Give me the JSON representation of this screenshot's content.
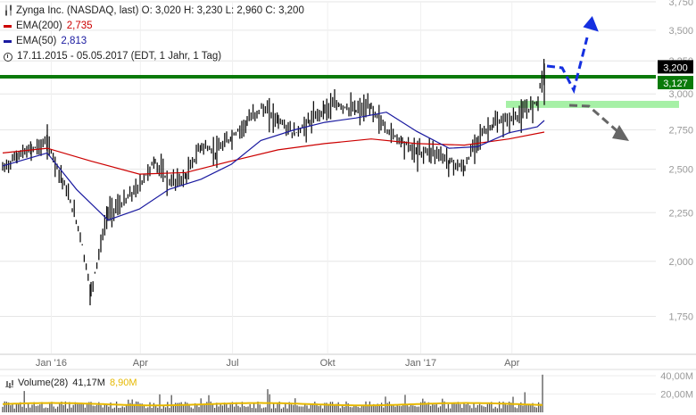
{
  "header": {
    "symbol_line": "Zynga Inc. (NASDAQ, last)  O: 3,020  H: 3,230  L: 2,960  C: 3,200",
    "ema200_label": "EMA(200)",
    "ema200_value": "2,735",
    "ema50_label": "EMA(50)",
    "ema50_value": "2,813",
    "range_line": "17.11.2015 - 05.05.2017  (EDT, 1 Jahr, 1 Tag)"
  },
  "volume_legend": {
    "label": "Volume(28)",
    "value": "41,17M",
    "avg_value": "8,90M"
  },
  "colors": {
    "price": "#111111",
    "ema200": "#cc0000",
    "ema50": "#1a1aa0",
    "resistance": "#0a7a0a",
    "support": "#a6f0a6",
    "arrow_up": "#1530e0",
    "arrow_down": "#666666",
    "last_price_box": "#000000",
    "resistance_box": "#0a7a0a",
    "volume_bar": "#555555",
    "volume_avg": "#e6b800"
  },
  "chart_data": {
    "type": "line",
    "title": "Zynga Inc. (NASDAQ, last)",
    "x_ticks": [
      "Jan '16",
      "Apr",
      "Jul",
      "Okt",
      "Jan '17",
      "Apr"
    ],
    "y_ticks": [
      "1,750",
      "2,000",
      "2,250",
      "2,500",
      "2,750",
      "3,000",
      "3,250",
      "3,500",
      "3,750"
    ],
    "ylim": [
      1.6,
      3.75
    ],
    "scale": "log",
    "volume_ticks": [
      "20,00M",
      "40,00M"
    ],
    "price_labels": {
      "last": "3,200",
      "resistance": "3,127"
    },
    "levels": {
      "resistance": 3.127,
      "support_band": [
        2.9,
        2.95
      ]
    },
    "series": [
      {
        "name": "Zynga Inc.",
        "x": [
          "2015-11-17",
          "2015-12-01",
          "2015-12-15",
          "2015-12-31",
          "2016-01-15",
          "2016-02-01",
          "2016-02-12",
          "2016-02-29",
          "2016-03-15",
          "2016-03-31",
          "2016-04-15",
          "2016-04-29",
          "2016-05-16",
          "2016-05-31",
          "2016-06-15",
          "2016-06-30",
          "2016-07-15",
          "2016-07-29",
          "2016-08-15",
          "2016-08-31",
          "2016-09-15",
          "2016-09-30",
          "2016-10-14",
          "2016-10-31",
          "2016-11-15",
          "2016-11-30",
          "2016-12-15",
          "2016-12-30",
          "2017-01-13",
          "2017-01-31",
          "2017-02-15",
          "2017-02-28",
          "2017-03-15",
          "2017-03-31",
          "2017-04-13",
          "2017-04-28",
          "2017-05-05"
        ],
        "values": [
          2.5,
          2.58,
          2.62,
          2.67,
          2.44,
          2.15,
          1.85,
          2.25,
          2.3,
          2.4,
          2.55,
          2.42,
          2.45,
          2.65,
          2.6,
          2.7,
          2.8,
          2.9,
          2.82,
          2.72,
          2.8,
          2.9,
          2.92,
          2.88,
          2.9,
          2.75,
          2.68,
          2.6,
          2.62,
          2.55,
          2.5,
          2.7,
          2.78,
          2.82,
          2.85,
          2.95,
          3.2
        ]
      },
      {
        "name": "EMA(200)",
        "x": [
          "2015-11-17",
          "2015-12-31",
          "2016-02-12",
          "2016-03-31",
          "2016-05-16",
          "2016-06-30",
          "2016-08-15",
          "2016-09-30",
          "2016-11-15",
          "2016-12-30",
          "2017-02-15",
          "2017-03-31",
          "2017-05-05"
        ],
        "values": [
          2.6,
          2.63,
          2.55,
          2.47,
          2.48,
          2.55,
          2.62,
          2.66,
          2.69,
          2.66,
          2.65,
          2.69,
          2.735
        ]
      },
      {
        "name": "EMA(50)",
        "x": [
          "2015-11-17",
          "2015-12-31",
          "2016-01-29",
          "2016-02-29",
          "2016-03-31",
          "2016-04-29",
          "2016-05-31",
          "2016-06-30",
          "2016-07-29",
          "2016-08-31",
          "2016-09-30",
          "2016-10-31",
          "2016-11-30",
          "2016-12-30",
          "2017-01-31",
          "2017-02-28",
          "2017-03-31",
          "2017-04-28",
          "2017-05-05"
        ],
        "values": [
          2.52,
          2.6,
          2.38,
          2.21,
          2.27,
          2.38,
          2.44,
          2.53,
          2.68,
          2.75,
          2.8,
          2.83,
          2.87,
          2.74,
          2.63,
          2.64,
          2.73,
          2.77,
          2.813
        ]
      }
    ]
  }
}
